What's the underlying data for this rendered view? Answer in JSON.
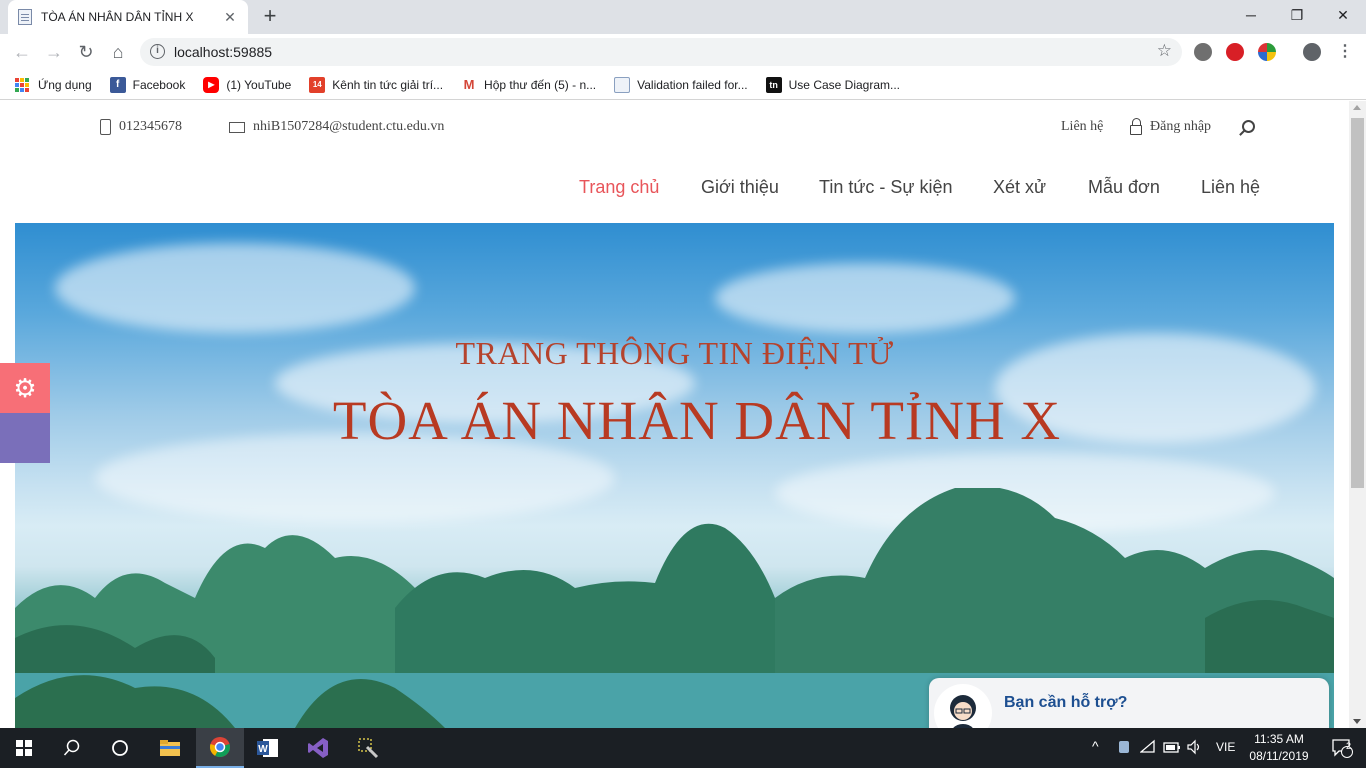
{
  "browser": {
    "tab_title": "TÒA ÁN NHÂN DÂN TỈNH X",
    "tab_close": "✕",
    "new_tab": "+",
    "url": "localhost:59885",
    "window_controls": {
      "minimize": "─",
      "maximize": "❐",
      "close": "✕"
    }
  },
  "bookmarks": [
    {
      "label": "Ứng dụng",
      "icon": "apps-grid-icon"
    },
    {
      "label": "Facebook",
      "icon": "facebook-icon",
      "color": "#3b5998",
      "glyph": "f"
    },
    {
      "label": "(1) YouTube",
      "icon": "youtube-icon",
      "color": "#ff0000",
      "glyph": "▶"
    },
    {
      "label": "Kênh tin tức giải trí...",
      "icon": "kenh14-icon",
      "color": "#e2402a",
      "glyph": "14"
    },
    {
      "label": "Hộp thư đến (5) - n...",
      "icon": "gmail-icon",
      "color": "#d44638",
      "glyph": "M"
    },
    {
      "label": "Validation failed for...",
      "icon": "document-icon",
      "color": "#8aa0c0",
      "glyph": ""
    },
    {
      "label": "Use Case Diagram...",
      "icon": "tn-icon",
      "color": "#111111",
      "glyph": "tn"
    }
  ],
  "topbar": {
    "phone": "012345678",
    "email": "nhiB1507284@student.ctu.edu.vn",
    "contact": "Liên hệ",
    "login": "Đăng nhập"
  },
  "nav": {
    "items": [
      "Trang chủ",
      "Giới thiệu",
      "Tin tức - Sự kiện",
      "Xét xử",
      "Mẫu đơn",
      "Liên hệ"
    ],
    "active_color": "#e8555a"
  },
  "hero": {
    "subtitle": "TRANG THÔNG TIN ĐIỆN TỬ",
    "title": "TÒA ÁN NHÂN DÂN TỈNH X",
    "title_color": "#b83a22"
  },
  "side_panel": {
    "gear_color": "#f76f77",
    "second_color": "#7a6fba"
  },
  "support": {
    "label": "Bạn cần hỗ trợ?"
  },
  "taskbar": {
    "lang": "VIE",
    "time": "11:35 AM",
    "date": "08/11/2019",
    "notification_count": "2"
  }
}
